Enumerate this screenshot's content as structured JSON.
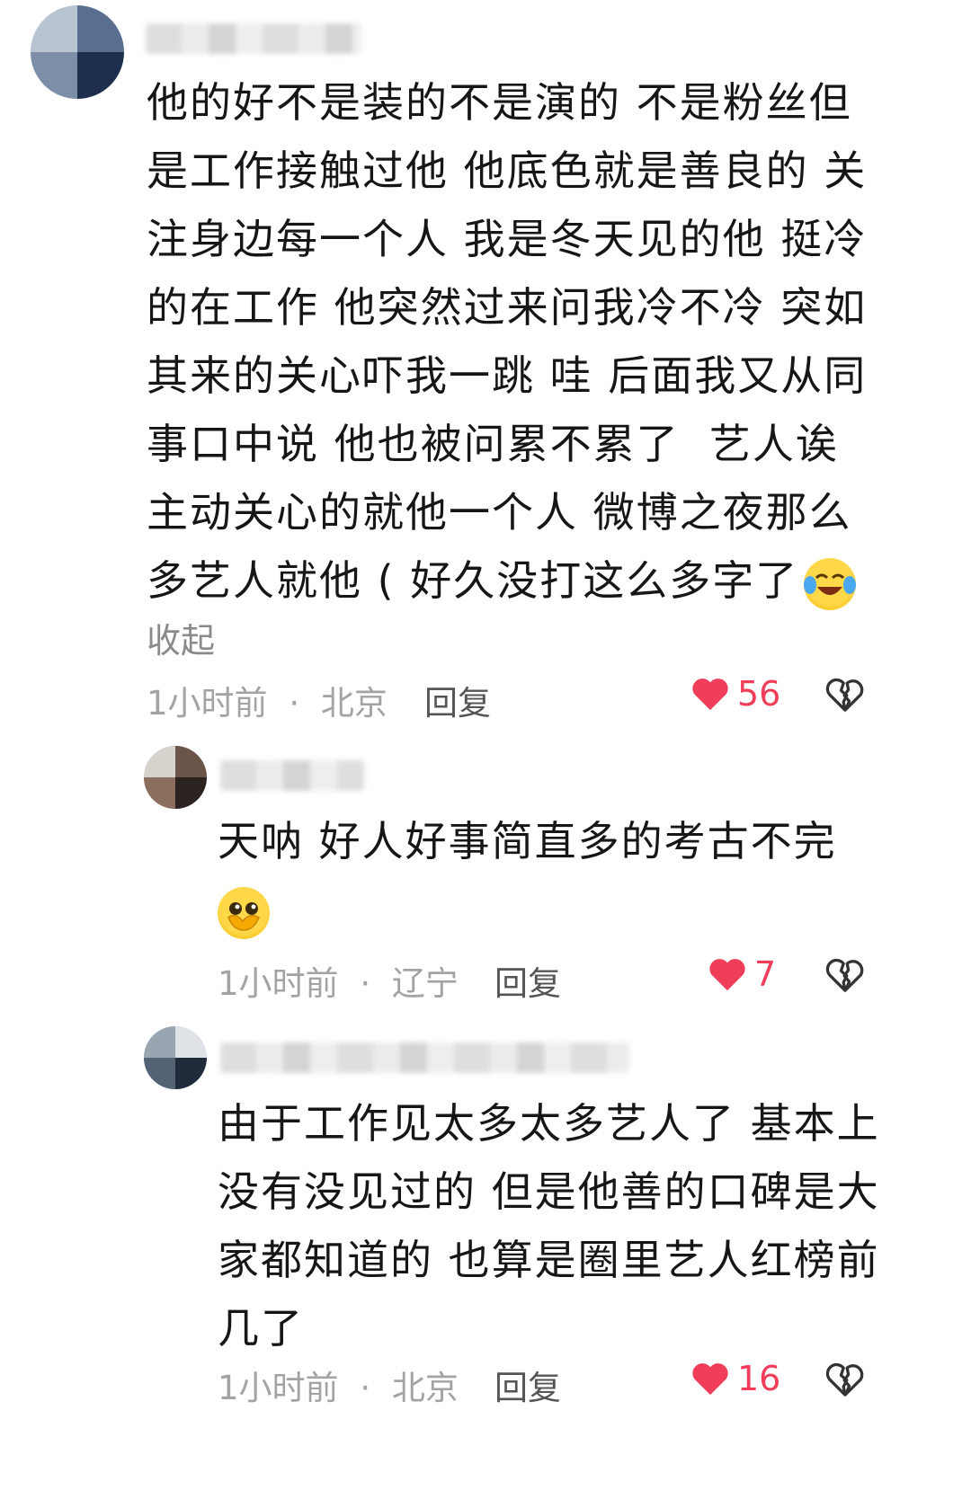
{
  "colors": {
    "like_red": "#f03e5a",
    "meta_gray": "#a3a3a3",
    "text": "#161616"
  },
  "comments": [
    {
      "lines": [
        "他的好不是装的不是演的 不是粉丝但",
        "是工作接触过他 他底色就是善良的 关",
        "注身边每一个人 我是冬天见的他 挺冷",
        "的在工作 他突然过来问我冷不冷 突如",
        "其来的关心吓我一跳 哇 后面我又从同",
        "事口中说 他也被问累不累了  艺人诶",
        "主动关心的就他一个人 微博之夜那么",
        "多艺人就他 ( 好久没打这么多字了"
      ],
      "emoji": "laughing-tears-emoji",
      "collapse_label": "收起",
      "time": "1小时前",
      "dot": "·",
      "location": "北京",
      "reply_label": "回复",
      "likes": "56"
    },
    {
      "lines": [
        "天呐 好人好事简直多的考古不完",
        ""
      ],
      "emoji": "pleading-face-emoji",
      "time": "1小时前",
      "dot": "·",
      "location": "辽宁",
      "reply_label": "回复",
      "likes": "7"
    },
    {
      "lines": [
        "由于工作见太多太多艺人了 基本上",
        "没有没见过的 但是他善的口碑是大",
        "家都知道的 也算是圈里艺人红榜前",
        "几了"
      ],
      "time": "1小时前",
      "dot": "·",
      "location": "北京",
      "reply_label": "回复",
      "likes": "16"
    }
  ]
}
